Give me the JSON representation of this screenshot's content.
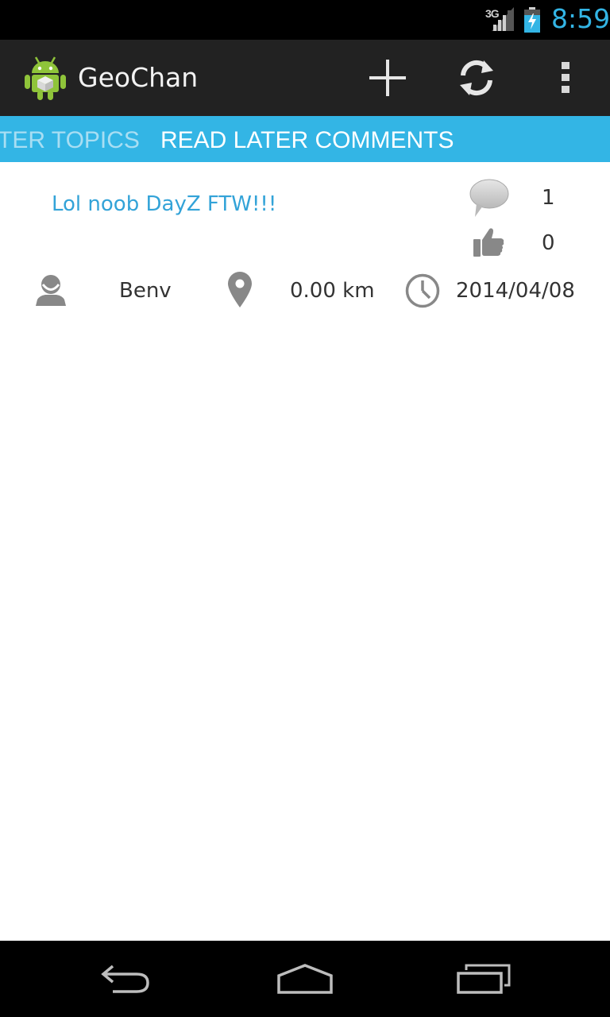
{
  "status_bar": {
    "network_label": "3G",
    "time": "8:59",
    "icons": [
      "signal-icon",
      "battery-charging-icon"
    ]
  },
  "action_bar": {
    "title": "GeoChan",
    "icons": [
      "android-app-icon",
      "add-icon",
      "refresh-icon",
      "overflow-menu-icon"
    ]
  },
  "tabs": {
    "previous_label": "TER TOPICS",
    "current_label": "READ LATER COMMENTS"
  },
  "comment": {
    "title": "Lol noob DayZ FTW!!!",
    "reply_count": "1",
    "like_count": "0",
    "author": "Benv",
    "distance": "0.00 km",
    "date": "2014/04/08"
  },
  "colors": {
    "accent": "#33b5e5",
    "action_bar": "#222222",
    "title_link": "#33a3d8"
  }
}
